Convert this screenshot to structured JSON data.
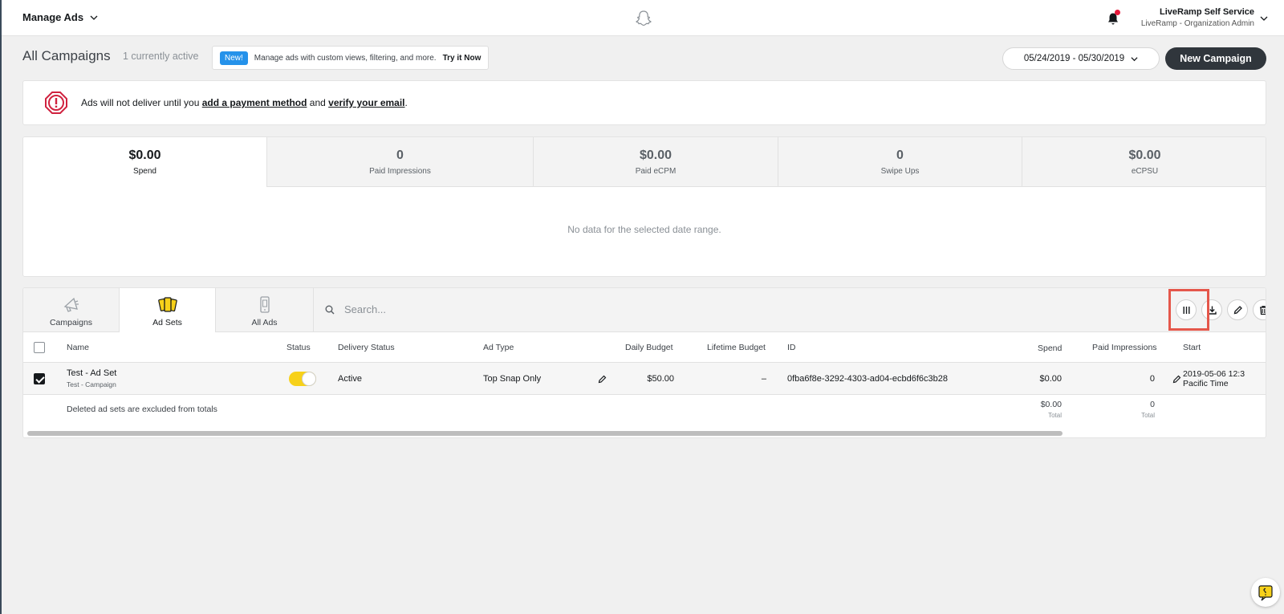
{
  "topbar": {
    "menu_label": "Manage Ads",
    "account_org": "LiveRamp Self Service",
    "account_role": "LiveRamp - Organization Admin"
  },
  "header": {
    "title": "All Campaigns",
    "active_count": "1 currently active",
    "promo_badge": "New!",
    "promo_text": "Manage ads with custom views, filtering, and more.",
    "promo_link": "Try it Now",
    "date_range": "05/24/2019 - 05/30/2019",
    "new_campaign": "New Campaign"
  },
  "alert": {
    "prefix": "Ads will not deliver until you ",
    "link1": "add a payment method",
    "middle": " and ",
    "link2": "verify your email",
    "suffix": "."
  },
  "stats": [
    {
      "value": "$0.00",
      "label": "Spend"
    },
    {
      "value": "0",
      "label": "Paid Impressions"
    },
    {
      "value": "$0.00",
      "label": "Paid eCPM"
    },
    {
      "value": "0",
      "label": "Swipe Ups"
    },
    {
      "value": "$0.00",
      "label": "eCPSU"
    }
  ],
  "no_data": "No data for the selected date range.",
  "tabs": [
    {
      "label": "Campaigns"
    },
    {
      "label": "Ad Sets"
    },
    {
      "label": "All Ads"
    }
  ],
  "search": {
    "placeholder": "Search..."
  },
  "columns": {
    "name": "Name",
    "status": "Status",
    "delivery_status": "Delivery Status",
    "ad_type": "Ad Type",
    "daily_budget": "Daily Budget",
    "lifetime_budget": "Lifetime Budget",
    "id": "ID",
    "spend": "Spend",
    "paid_impressions": "Paid Impressions",
    "start": "Start"
  },
  "rows": [
    {
      "name": "Test - Ad Set",
      "campaign": "Test - Campaign",
      "delivery_status": "Active",
      "ad_type": "Top Snap Only",
      "daily_budget": "$50.00",
      "lifetime_budget": "–",
      "id": "0fba6f8e-3292-4303-ad04-ecbd6f6c3b28",
      "spend": "$0.00",
      "paid_impressions": "0",
      "start_line1": "2019-05-06 12:3",
      "start_line2": "Pacific Time"
    }
  ],
  "footer": {
    "note": "Deleted ad sets are excluded from totals",
    "spend_total": "$0.00",
    "impressions_total": "0",
    "total_label": "Total"
  }
}
